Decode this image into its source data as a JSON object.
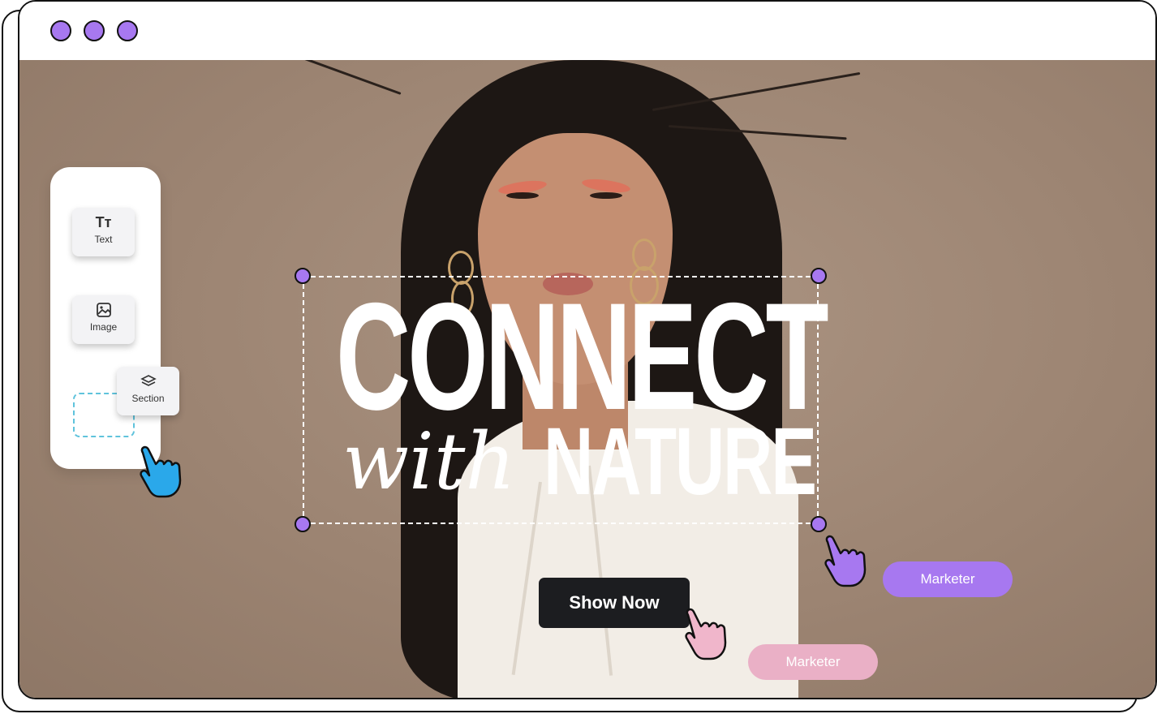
{
  "window": {
    "dots": [
      "window-dot-1",
      "window-dot-2",
      "window-dot-3"
    ],
    "accent": "#a778f0"
  },
  "tools": {
    "items": [
      {
        "label": "Text",
        "icon": "text-size-icon"
      },
      {
        "label": "Image",
        "icon": "image-icon"
      },
      {
        "label": "Section",
        "icon": "layers-icon"
      }
    ]
  },
  "headline": {
    "line1": "CONNECT",
    "script": "with",
    "line2": "NATURE"
  },
  "cta": {
    "label": "Show Now"
  },
  "collaborators": [
    {
      "label": "Marketer",
      "color": "#a778f0"
    },
    {
      "label": "Marketer",
      "color": "#eab0c6"
    }
  ],
  "cursor_colors": {
    "blue": "#2aa8ea",
    "purple": "#a778f0",
    "pink": "#f0b6cb"
  }
}
